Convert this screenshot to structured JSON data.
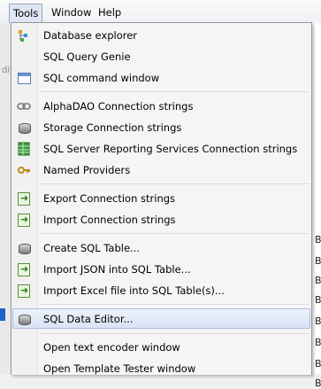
{
  "menubar": {
    "tools": "Tools",
    "window": "Window",
    "help": "Help"
  },
  "menu": {
    "items": [
      {
        "label": "Database explorer",
        "icon": "database-explorer-icon"
      },
      {
        "label": "SQL Query Genie",
        "icon": ""
      },
      {
        "label": "SQL command window",
        "icon": "window-icon"
      },
      {
        "label": "AlphaDAO Connection strings",
        "icon": "chain-link-icon"
      },
      {
        "label": "Storage Connection strings",
        "icon": "database-cylinder-icon"
      },
      {
        "label": "SQL Server Reporting Services Connection strings",
        "icon": "report-grid-icon"
      },
      {
        "label": "Named Providers",
        "icon": "key-icon"
      },
      {
        "label": "Export Connection strings",
        "icon": "export-icon"
      },
      {
        "label": "Import Connection strings",
        "icon": "import-icon"
      },
      {
        "label": "Create SQL Table...",
        "icon": "create-table-icon"
      },
      {
        "label": "Import JSON into SQL Table...",
        "icon": "import-json-icon"
      },
      {
        "label": "Import Excel file into SQL Table(s)...",
        "icon": "import-excel-icon"
      },
      {
        "label": "SQL Data Editor...",
        "icon": "database-cylinder-icon"
      },
      {
        "label": "Open text encoder window",
        "icon": ""
      },
      {
        "label": "Open Template Tester window",
        "icon": ""
      }
    ]
  },
  "background": {
    "right_chars": [
      "B",
      "B",
      "B",
      "B",
      "B",
      "B",
      "B",
      "B",
      "B",
      "B",
      "B",
      "B"
    ],
    "left_fragments": [
      "dit"
    ]
  },
  "colors": {
    "highlight": "#d9e3f5",
    "selection_blue": "#1c64c8"
  }
}
